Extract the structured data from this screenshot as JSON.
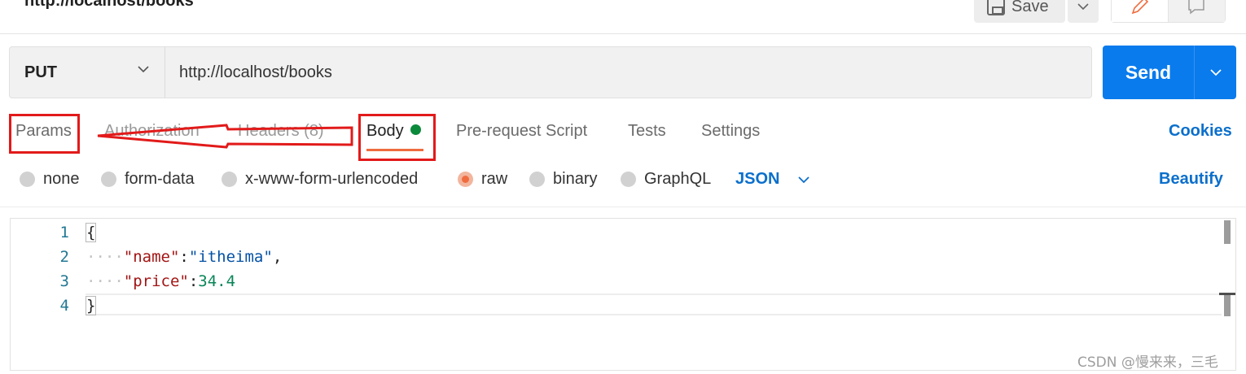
{
  "header": {
    "title": "http://localhost/books",
    "save_label": "Save"
  },
  "request": {
    "method": "PUT",
    "url": "http://localhost/books",
    "send_label": "Send"
  },
  "tabs": [
    {
      "label": "Params"
    },
    {
      "label": "Authorization"
    },
    {
      "label": "Headers (8)"
    },
    {
      "label": "Body"
    },
    {
      "label": "Pre-request Script"
    },
    {
      "label": "Tests"
    },
    {
      "label": "Settings"
    }
  ],
  "active_tab": "Body",
  "cookies_label": "Cookies",
  "body_options": [
    {
      "label": "none",
      "selected": false
    },
    {
      "label": "form-data",
      "selected": false
    },
    {
      "label": "x-www-form-urlencoded",
      "selected": false
    },
    {
      "label": "raw",
      "selected": true
    },
    {
      "label": "binary",
      "selected": false
    },
    {
      "label": "GraphQL",
      "selected": false
    }
  ],
  "format": "JSON",
  "beautify_label": "Beautify",
  "editor": {
    "line_numbers": [
      "1",
      "2",
      "3",
      "4"
    ],
    "open_brace": "{",
    "close_brace": "}",
    "indent": "····",
    "name_key": "\"name\"",
    "name_value": "\"itheima\"",
    "price_key": "\"price\"",
    "price_value": "34.4",
    "colon": ":",
    "comma": ","
  },
  "watermark": "CSDN @慢来来，三毛",
  "colors": {
    "send": "#097bed",
    "link": "#0b6fcc",
    "accent": "#ef6c3f",
    "body_dot": "#0c8a3c",
    "annotation": "#e21a1a"
  }
}
